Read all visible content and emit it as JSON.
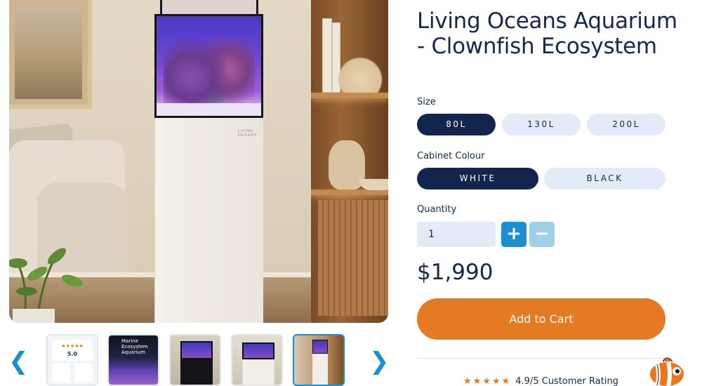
{
  "product": {
    "title": "Living Oceans Aquarium - Clownfish Ecosystem",
    "price": "$1,990",
    "add_to_cart_label": "Add to Cart",
    "brand_mark": "LIVING OCEANS"
  },
  "size": {
    "label": "Size",
    "options": [
      "80L",
      "130L",
      "200L"
    ],
    "selected": "80L"
  },
  "cabinet": {
    "label": "Cabinet Colour",
    "options": [
      "WHITE",
      "BLACK"
    ],
    "selected": "WHITE"
  },
  "quantity": {
    "label": "Quantity",
    "value": "1",
    "plus_label": "+",
    "minus_label": "−"
  },
  "gallery": {
    "prev_icon": "chevron-left-icon",
    "next_icon": "chevron-right-icon",
    "prev_glyph": "❮",
    "next_glyph": "❯",
    "active_index": 4,
    "thumb1_rating": "5.0",
    "thumb2_text": "Marine Ecosystem Aquarium"
  },
  "rating": {
    "stars": "★★★★★",
    "text": "4.9/5 Customer Rating"
  },
  "colors": {
    "navy": "#12264d",
    "light_pill": "#e4ebf8",
    "accent_blue": "#1a8fd1",
    "orange": "#e57a24"
  }
}
